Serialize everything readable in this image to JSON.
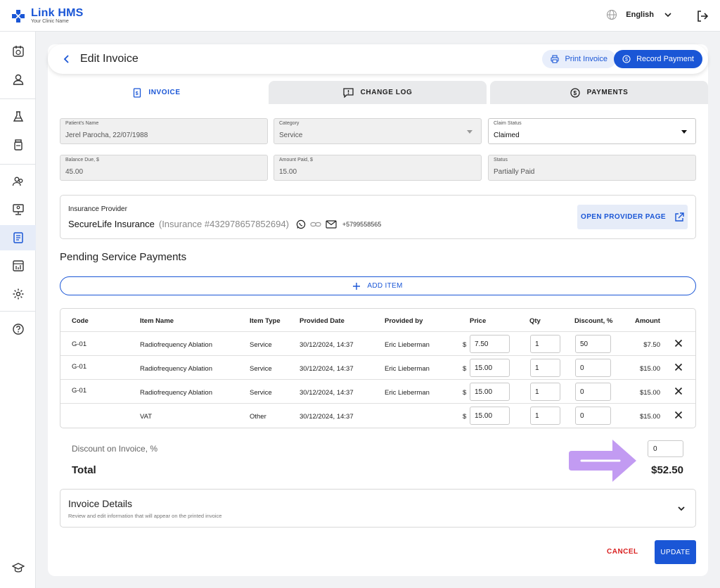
{
  "app": {
    "name": "Link HMS",
    "tagline": "Your Clinic Name",
    "language": "English"
  },
  "colors": {
    "accent": "#1a56d6",
    "danger": "#d92020",
    "annotation_arrow": "#c29bf2"
  },
  "header": {
    "title": "Edit Invoice",
    "print_label": "Print Invoice",
    "record_label": "Record Payment"
  },
  "tabs": [
    {
      "label": "INVOICE",
      "icon": "invoice-icon"
    },
    {
      "label": "CHANGE LOG",
      "icon": "comment-alert-icon"
    },
    {
      "label": "PAYMENTS",
      "icon": "dollar-circle-icon"
    }
  ],
  "fields": {
    "patient": {
      "label": "Patient's Name",
      "value": "Jerel Parocha, 22/07/1988"
    },
    "category": {
      "label": "Category",
      "value": "Service"
    },
    "claim_status": {
      "label": "Claim Status",
      "value": "Claimed"
    },
    "balance_due": {
      "label": "Balance Due, $",
      "value": "45.00"
    },
    "amount_paid": {
      "label": "Amount Paid, $",
      "value": "15.00"
    },
    "status": {
      "label": "Status",
      "value": "Partially Paid"
    }
  },
  "insurance": {
    "label": "Insurance Provider",
    "name": "SecureLife Insurance",
    "number": "(Insurance #432978657852694)",
    "phone": "+5799558565",
    "open_label": "OPEN PROVIDER PAGE"
  },
  "pending": {
    "title": "Pending Service Payments",
    "add_label": "ADD ITEM"
  },
  "table": {
    "headers": {
      "code": "Code",
      "name": "Item Name",
      "type": "Item Type",
      "date": "Provided Date",
      "by": "Provided by",
      "price": "Price",
      "qty": "Qty",
      "discount": "Discount, %",
      "amount": "Amount"
    },
    "currency": "$",
    "rows": [
      {
        "code": "G-01",
        "name": "Radiofrequency Ablation",
        "type": "Service",
        "date": "30/12/2024, 14:37",
        "by": "Eric Lieberman",
        "price": "7.50",
        "qty": "1",
        "discount": "50",
        "amount": "$7.50"
      },
      {
        "code": "G-01",
        "name": "Radiofrequency Ablation",
        "type": "Service",
        "date": "30/12/2024, 14:37",
        "by": "Eric Lieberman",
        "price": "15.00",
        "qty": "1",
        "discount": "0",
        "amount": "$15.00"
      },
      {
        "code": "G-01",
        "name": "Radiofrequency Ablation",
        "type": "Service",
        "date": "30/12/2024, 14:37",
        "by": "Eric Lieberman",
        "price": "15.00",
        "qty": "1",
        "discount": "0",
        "amount": "$15.00"
      },
      {
        "code": "",
        "name": "VAT",
        "type": "Other",
        "date": "30/12/2024, 14:37",
        "by": "",
        "price": "15.00",
        "qty": "1",
        "discount": "0",
        "amount": "$15.00"
      }
    ]
  },
  "totals": {
    "discount_label": "Discount on Invoice, %",
    "discount_value": "0",
    "total_label": "Total",
    "total_value": "$52.50"
  },
  "details": {
    "title": "Invoice Details",
    "subtitle": "Review and edit information that will appear on the printed invoice"
  },
  "footer": {
    "cancel_label": "CANCEL",
    "update_label": "UPDATE"
  }
}
